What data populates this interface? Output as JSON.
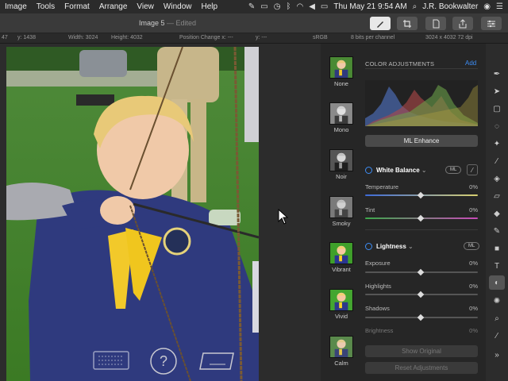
{
  "menubar": {
    "items": [
      "Image",
      "Tools",
      "Format",
      "Arrange",
      "View",
      "Window",
      "Help"
    ],
    "datetime": "Thu May 21  9:54 AM",
    "user": "J.R. Bookwalter"
  },
  "toolbar": {
    "doc_name": "Image 5",
    "doc_status": "— Edited"
  },
  "infobar": {
    "x": "47",
    "y": "y: 1438",
    "width": "Width: 3024",
    "height": "Height: 4032",
    "position_change": "Position Change x: ---",
    "position_y": "y: ---",
    "colorspace": "sRGB",
    "bits": "8 bits per channel",
    "dimensions": "3024 x 4032 72 dpi"
  },
  "presets": [
    {
      "label": "None"
    },
    {
      "label": "Mono"
    },
    {
      "label": "Noir"
    },
    {
      "label": "Smoky"
    },
    {
      "label": "Vibrant"
    },
    {
      "label": "Vivid"
    },
    {
      "label": "Calm"
    }
  ],
  "adjustments": {
    "header": "COLOR ADJUSTMENTS",
    "add_label": "Add",
    "ml_enhance": "ML Enhance",
    "white_balance": {
      "title": "White Balance",
      "ml": "ML",
      "temperature_label": "Temperature",
      "temperature_value": "0%",
      "tint_label": "Tint",
      "tint_value": "0%"
    },
    "lightness": {
      "title": "Lightness",
      "ml": "ML",
      "exposure_label": "Exposure",
      "exposure_value": "0%",
      "highlights_label": "Highlights",
      "highlights_value": "0%",
      "shadows_label": "Shadows",
      "shadows_value": "0%",
      "brightness_label": "Brightness",
      "brightness_value": "0%"
    },
    "show_original": "Show Original",
    "reset": "Reset Adjustments"
  },
  "colors": {
    "accent": "#3d8df5",
    "panel_bg": "#262626",
    "toolbar_bg": "#3a3a3a"
  }
}
